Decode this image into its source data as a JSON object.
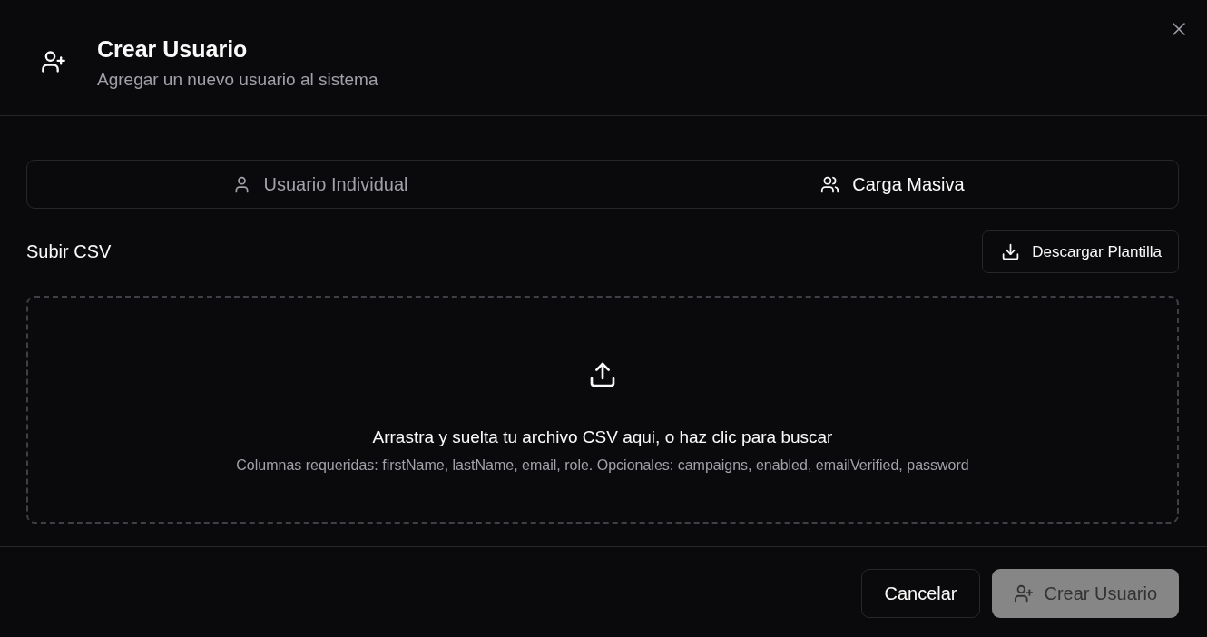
{
  "dialog": {
    "title": "Crear Usuario",
    "subtitle": "Agregar un nuevo usuario al sistema"
  },
  "tabs": [
    {
      "label": "Usuario Individual",
      "kind": "single",
      "selected": false
    },
    {
      "label": "Carga Masiva",
      "kind": "bulk",
      "selected": true
    }
  ],
  "upload": {
    "label": "Subir CSV",
    "template_button": "Descargar Plantilla",
    "dropzone": {
      "title": "Arrastra y suelta tu archivo CSV aqui, o haz clic para buscar",
      "hint": "Columnas requeridas: firstName, lastName, email, role. Opcionales: campaigns, enabled, emailVerified, password"
    }
  },
  "footer": {
    "buttons": [
      {
        "label": "Cancelar",
        "kind": "secondary",
        "disabled": false
      },
      {
        "label": "Crear Usuario",
        "kind": "primary",
        "disabled": true
      }
    ]
  }
}
